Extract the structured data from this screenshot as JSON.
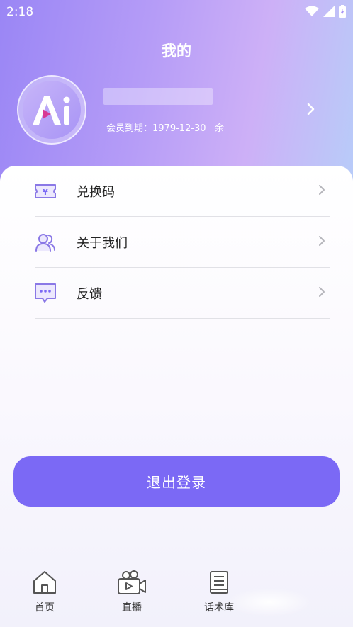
{
  "status_bar": {
    "time": "2:18"
  },
  "header": {
    "title": "我的"
  },
  "profile": {
    "membership_label": "会员到期：",
    "membership_date": "1979-12-30",
    "membership_suffix": "余"
  },
  "menu": [
    {
      "label": "兑换码",
      "icon": "ticket-icon"
    },
    {
      "label": "关于我们",
      "icon": "users-icon"
    },
    {
      "label": "反馈",
      "icon": "chat-bubble-icon"
    }
  ],
  "logout": {
    "label": "退出登录"
  },
  "tabbar": [
    {
      "label": "首页",
      "icon": "home-icon"
    },
    {
      "label": "直播",
      "icon": "live-camera-icon"
    },
    {
      "label": "话术库",
      "icon": "book-icon"
    }
  ],
  "colors": {
    "accent": "#7b69f5",
    "icon_stroke": "#8a78e6"
  }
}
